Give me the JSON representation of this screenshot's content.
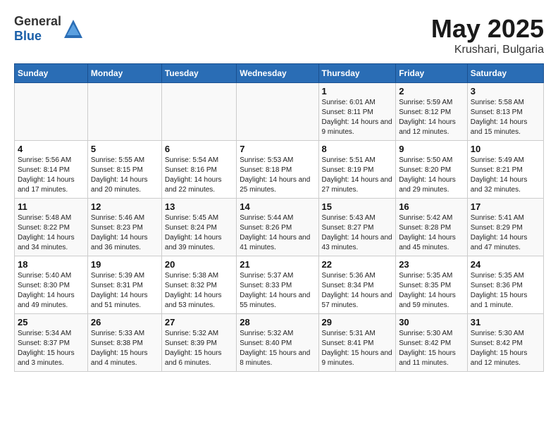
{
  "header": {
    "logo_general": "General",
    "logo_blue": "Blue",
    "title": "May 2025",
    "location": "Krushari, Bulgaria"
  },
  "days_of_week": [
    "Sunday",
    "Monday",
    "Tuesday",
    "Wednesday",
    "Thursday",
    "Friday",
    "Saturday"
  ],
  "weeks": [
    [
      {
        "day": "",
        "sunrise": "",
        "sunset": "",
        "daylight": ""
      },
      {
        "day": "",
        "sunrise": "",
        "sunset": "",
        "daylight": ""
      },
      {
        "day": "",
        "sunrise": "",
        "sunset": "",
        "daylight": ""
      },
      {
        "day": "",
        "sunrise": "",
        "sunset": "",
        "daylight": ""
      },
      {
        "day": "1",
        "sunrise": "Sunrise: 6:01 AM",
        "sunset": "Sunset: 8:11 PM",
        "daylight": "Daylight: 14 hours and 9 minutes."
      },
      {
        "day": "2",
        "sunrise": "Sunrise: 5:59 AM",
        "sunset": "Sunset: 8:12 PM",
        "daylight": "Daylight: 14 hours and 12 minutes."
      },
      {
        "day": "3",
        "sunrise": "Sunrise: 5:58 AM",
        "sunset": "Sunset: 8:13 PM",
        "daylight": "Daylight: 14 hours and 15 minutes."
      }
    ],
    [
      {
        "day": "4",
        "sunrise": "Sunrise: 5:56 AM",
        "sunset": "Sunset: 8:14 PM",
        "daylight": "Daylight: 14 hours and 17 minutes."
      },
      {
        "day": "5",
        "sunrise": "Sunrise: 5:55 AM",
        "sunset": "Sunset: 8:15 PM",
        "daylight": "Daylight: 14 hours and 20 minutes."
      },
      {
        "day": "6",
        "sunrise": "Sunrise: 5:54 AM",
        "sunset": "Sunset: 8:16 PM",
        "daylight": "Daylight: 14 hours and 22 minutes."
      },
      {
        "day": "7",
        "sunrise": "Sunrise: 5:53 AM",
        "sunset": "Sunset: 8:18 PM",
        "daylight": "Daylight: 14 hours and 25 minutes."
      },
      {
        "day": "8",
        "sunrise": "Sunrise: 5:51 AM",
        "sunset": "Sunset: 8:19 PM",
        "daylight": "Daylight: 14 hours and 27 minutes."
      },
      {
        "day": "9",
        "sunrise": "Sunrise: 5:50 AM",
        "sunset": "Sunset: 8:20 PM",
        "daylight": "Daylight: 14 hours and 29 minutes."
      },
      {
        "day": "10",
        "sunrise": "Sunrise: 5:49 AM",
        "sunset": "Sunset: 8:21 PM",
        "daylight": "Daylight: 14 hours and 32 minutes."
      }
    ],
    [
      {
        "day": "11",
        "sunrise": "Sunrise: 5:48 AM",
        "sunset": "Sunset: 8:22 PM",
        "daylight": "Daylight: 14 hours and 34 minutes."
      },
      {
        "day": "12",
        "sunrise": "Sunrise: 5:46 AM",
        "sunset": "Sunset: 8:23 PM",
        "daylight": "Daylight: 14 hours and 36 minutes."
      },
      {
        "day": "13",
        "sunrise": "Sunrise: 5:45 AM",
        "sunset": "Sunset: 8:24 PM",
        "daylight": "Daylight: 14 hours and 39 minutes."
      },
      {
        "day": "14",
        "sunrise": "Sunrise: 5:44 AM",
        "sunset": "Sunset: 8:26 PM",
        "daylight": "Daylight: 14 hours and 41 minutes."
      },
      {
        "day": "15",
        "sunrise": "Sunrise: 5:43 AM",
        "sunset": "Sunset: 8:27 PM",
        "daylight": "Daylight: 14 hours and 43 minutes."
      },
      {
        "day": "16",
        "sunrise": "Sunrise: 5:42 AM",
        "sunset": "Sunset: 8:28 PM",
        "daylight": "Daylight: 14 hours and 45 minutes."
      },
      {
        "day": "17",
        "sunrise": "Sunrise: 5:41 AM",
        "sunset": "Sunset: 8:29 PM",
        "daylight": "Daylight: 14 hours and 47 minutes."
      }
    ],
    [
      {
        "day": "18",
        "sunrise": "Sunrise: 5:40 AM",
        "sunset": "Sunset: 8:30 PM",
        "daylight": "Daylight: 14 hours and 49 minutes."
      },
      {
        "day": "19",
        "sunrise": "Sunrise: 5:39 AM",
        "sunset": "Sunset: 8:31 PM",
        "daylight": "Daylight: 14 hours and 51 minutes."
      },
      {
        "day": "20",
        "sunrise": "Sunrise: 5:38 AM",
        "sunset": "Sunset: 8:32 PM",
        "daylight": "Daylight: 14 hours and 53 minutes."
      },
      {
        "day": "21",
        "sunrise": "Sunrise: 5:37 AM",
        "sunset": "Sunset: 8:33 PM",
        "daylight": "Daylight: 14 hours and 55 minutes."
      },
      {
        "day": "22",
        "sunrise": "Sunrise: 5:36 AM",
        "sunset": "Sunset: 8:34 PM",
        "daylight": "Daylight: 14 hours and 57 minutes."
      },
      {
        "day": "23",
        "sunrise": "Sunrise: 5:35 AM",
        "sunset": "Sunset: 8:35 PM",
        "daylight": "Daylight: 14 hours and 59 minutes."
      },
      {
        "day": "24",
        "sunrise": "Sunrise: 5:35 AM",
        "sunset": "Sunset: 8:36 PM",
        "daylight": "Daylight: 15 hours and 1 minute."
      }
    ],
    [
      {
        "day": "25",
        "sunrise": "Sunrise: 5:34 AM",
        "sunset": "Sunset: 8:37 PM",
        "daylight": "Daylight: 15 hours and 3 minutes."
      },
      {
        "day": "26",
        "sunrise": "Sunrise: 5:33 AM",
        "sunset": "Sunset: 8:38 PM",
        "daylight": "Daylight: 15 hours and 4 minutes."
      },
      {
        "day": "27",
        "sunrise": "Sunrise: 5:32 AM",
        "sunset": "Sunset: 8:39 PM",
        "daylight": "Daylight: 15 hours and 6 minutes."
      },
      {
        "day": "28",
        "sunrise": "Sunrise: 5:32 AM",
        "sunset": "Sunset: 8:40 PM",
        "daylight": "Daylight: 15 hours and 8 minutes."
      },
      {
        "day": "29",
        "sunrise": "Sunrise: 5:31 AM",
        "sunset": "Sunset: 8:41 PM",
        "daylight": "Daylight: 15 hours and 9 minutes."
      },
      {
        "day": "30",
        "sunrise": "Sunrise: 5:30 AM",
        "sunset": "Sunset: 8:42 PM",
        "daylight": "Daylight: 15 hours and 11 minutes."
      },
      {
        "day": "31",
        "sunrise": "Sunrise: 5:30 AM",
        "sunset": "Sunset: 8:42 PM",
        "daylight": "Daylight: 15 hours and 12 minutes."
      }
    ]
  ]
}
